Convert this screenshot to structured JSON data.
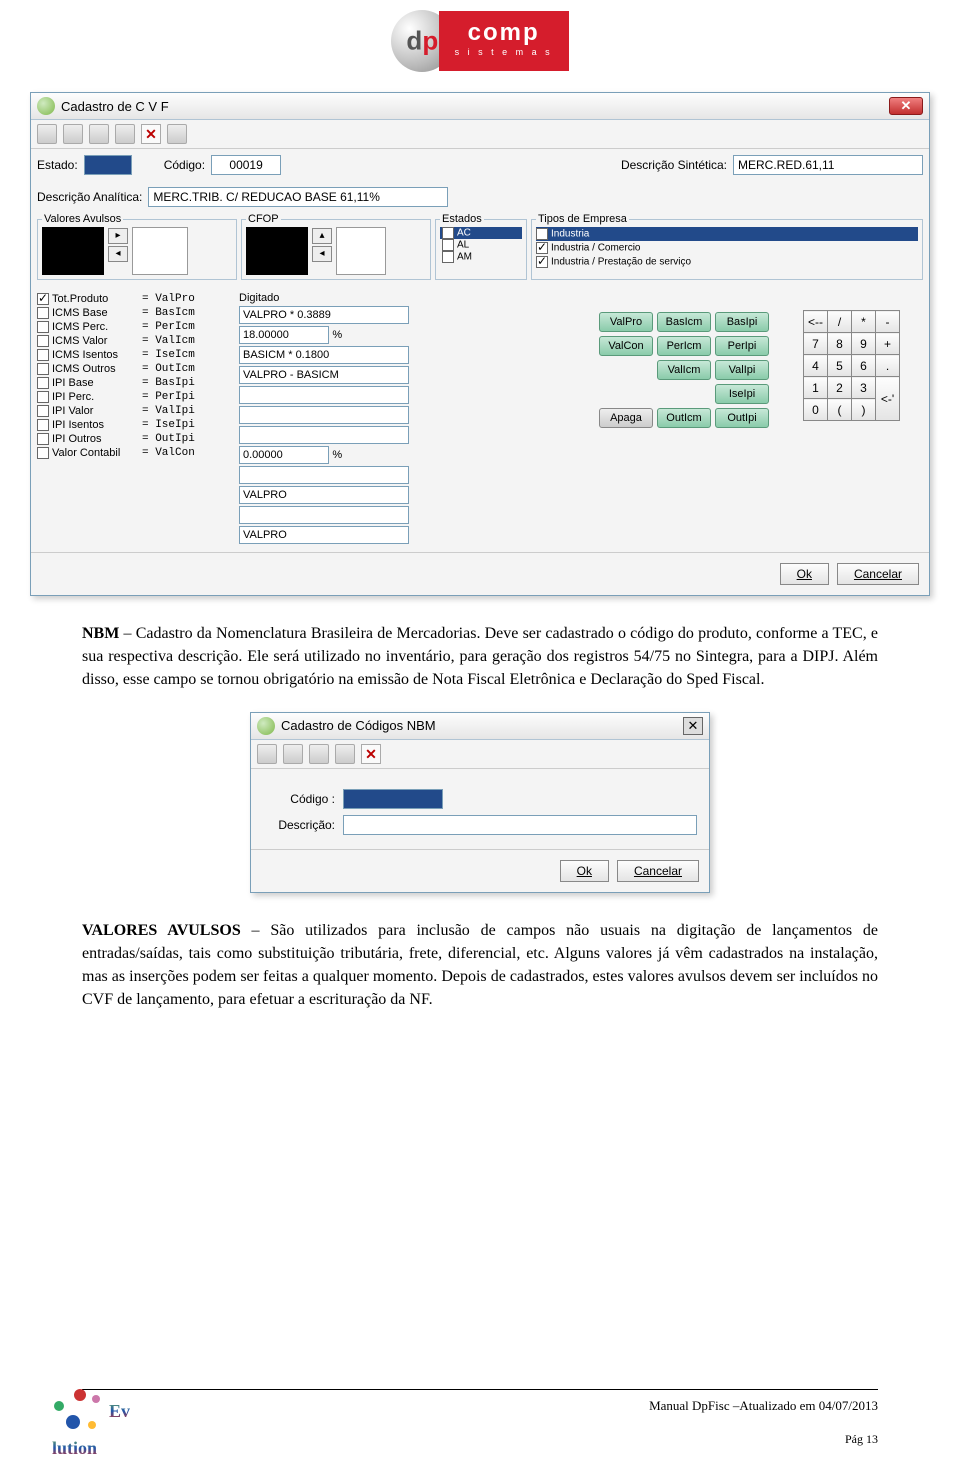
{
  "logo": {
    "dp": {
      "d": "d",
      "p": "p"
    },
    "comp": "comp",
    "sistemas": "s i s t e m a s"
  },
  "win1": {
    "title": "Cadastro de C V F",
    "estado_lbl": "Estado:",
    "codigo_lbl": "Código:",
    "codigo_val": "00019",
    "descsin_lbl": "Descrição Sintética:",
    "descsin_val": "MERC.RED.61,11",
    "descana_lbl": "Descrição Analítica:",
    "descana_val": "MERC.TRIB. C/ REDUCAO BASE 61,11%",
    "fs_valores": "Valores Avulsos",
    "fs_cfop": "CFOP",
    "fs_estados": "Estados",
    "fs_tipos": "Tipos de Empresa",
    "estados": [
      "AC",
      "AL",
      "AM"
    ],
    "tipos": [
      "Industria",
      "Industria / Comercio",
      "Industria / Prestação de serviço"
    ],
    "leftrows": [
      {
        "chk": true,
        "name": "Tot.Produto",
        "eq": "= ValPro"
      },
      {
        "chk": false,
        "name": "ICMS Base",
        "eq": "= BasIcm"
      },
      {
        "chk": false,
        "name": "ICMS Perc.",
        "eq": "= PerIcm"
      },
      {
        "chk": false,
        "name": "ICMS Valor",
        "eq": "= ValIcm"
      },
      {
        "chk": false,
        "name": "ICMS Isentos",
        "eq": "= IseIcm"
      },
      {
        "chk": false,
        "name": "ICMS Outros",
        "eq": "= OutIcm"
      },
      {
        "chk": false,
        "name": "IPI Base",
        "eq": "= BasIpi"
      },
      {
        "chk": false,
        "name": "IPI Perc.",
        "eq": "= PerIpi"
      },
      {
        "chk": false,
        "name": "IPI Valor",
        "eq": "= ValIpi"
      },
      {
        "chk": false,
        "name": "IPI Isentos",
        "eq": "= IseIpi"
      },
      {
        "chk": false,
        "name": "IPI Outros",
        "eq": "= OutIpi"
      },
      {
        "chk": false,
        "name": "Valor Contabil",
        "eq": "= ValCon"
      }
    ],
    "digitado_lbl": "Digitado",
    "inputs": [
      "VALPRO * 0.3889",
      "18.00000",
      "BASICM * 0.1800",
      "VALPRO - BASICM",
      "",
      "",
      "",
      "0.00000",
      "",
      "VALPRO",
      "",
      "VALPRO"
    ],
    "pct": "%",
    "greenbtns": [
      [
        "ValPro",
        "BasIcm",
        "BasIpi"
      ],
      [
        "ValCon",
        "PerIcm",
        "PerIpi"
      ],
      [
        "",
        "ValIcm",
        "ValIpi"
      ],
      [
        "",
        "",
        "IseIpi"
      ],
      [
        "Apaga",
        "OutIcm",
        "OutIpi"
      ]
    ],
    "keypad": [
      [
        "<--",
        "/",
        "*",
        "-"
      ],
      [
        "7",
        "8",
        "9",
        "+"
      ],
      [
        "4",
        "5",
        "6",
        "."
      ],
      [
        "1",
        "2",
        "3",
        "<-'"
      ],
      [
        "0",
        "(",
        ")",
        ""
      ]
    ],
    "ok": "Ok",
    "cancel": "Cancelar"
  },
  "para1_b": "NBM",
  "para1": " – Cadastro da Nomenclatura Brasileira de Mercadorias. Deve ser cadastrado o código do produto, conforme a TEC, e sua respectiva descrição. Ele será utilizado no inventário, para geração dos registros 54/75 no Sintegra, para a DIPJ. Além disso, esse campo se tornou obrigatório na emissão de Nota Fiscal Eletrônica e Declaração do Sped Fiscal.",
  "win2": {
    "title": "Cadastro de Códigos NBM",
    "codigo": "Código :",
    "descricao": "Descrição:",
    "ok": "Ok",
    "cancel": "Cancelar"
  },
  "para2_b": "VALORES AVULSOS",
  "para2": " – São utilizados para inclusão de campos não usuais na digitação de lançamentos de entradas/saídas, tais como substituição tributária, frete, diferencial, etc. Alguns valores já vêm cadastrados na instalação, mas as inserções podem ser feitas a qualquer momento. Depois de cadastrados, estes valores avulsos devem ser incluídos no CVF de lançamento, para efetuar a escrituração da NF.",
  "footer": {
    "line": "Manual DpFisc –Atualizado em  04/07/2013",
    "page": "Pág 13",
    "ev": "Ev   lution"
  }
}
